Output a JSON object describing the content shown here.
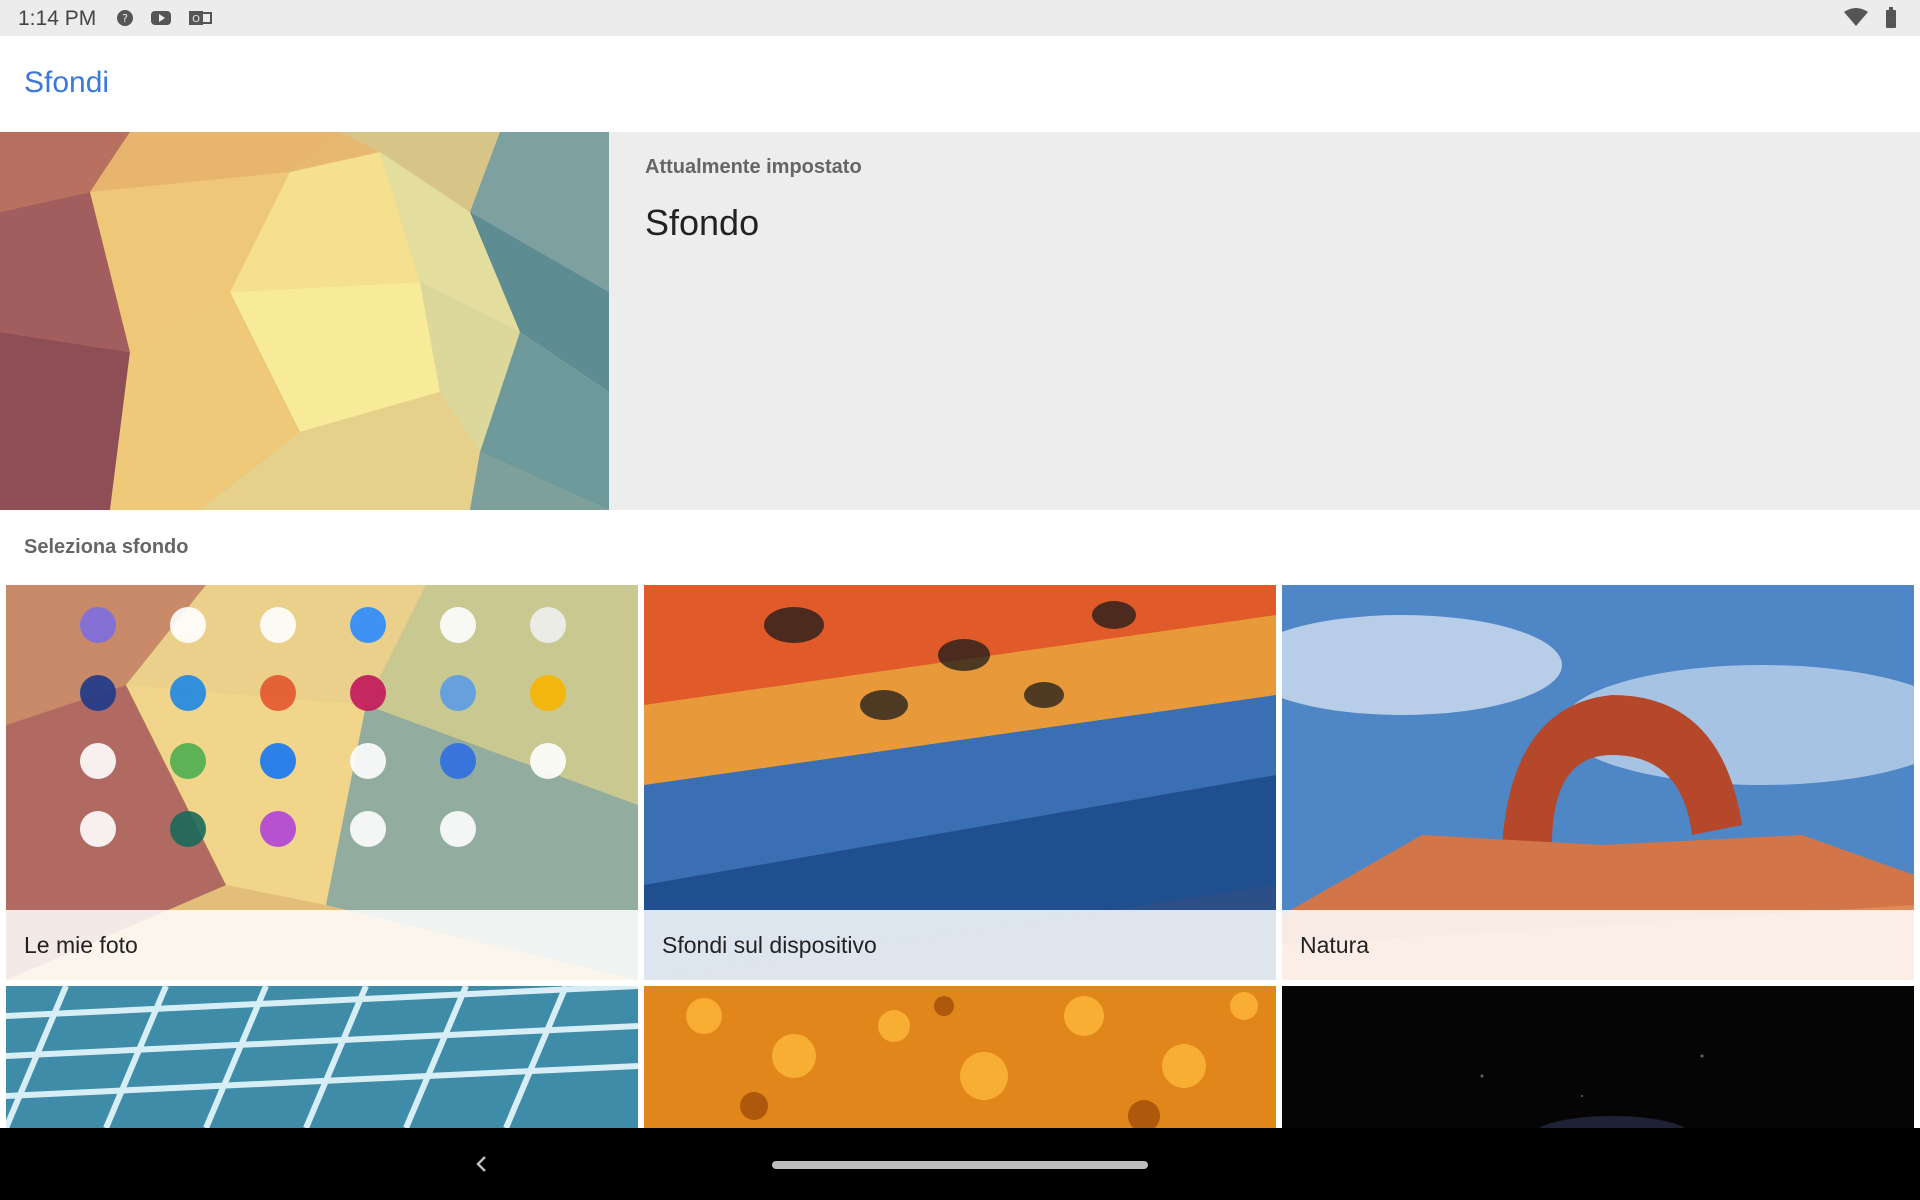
{
  "status_bar": {
    "time": "1:14 PM",
    "icons": [
      "notification-icon",
      "youtube-icon",
      "outlook-icon"
    ],
    "right_icons": [
      "wifi-icon",
      "battery-icon"
    ]
  },
  "app_bar": {
    "title": "Sfondi"
  },
  "current": {
    "subtitle": "Attualmente impostato",
    "name": "Sfondo"
  },
  "section_title": "Seleziona sfondo",
  "tiles": [
    {
      "label": "Le mie foto"
    },
    {
      "label": "Sfondi sul dispositivo"
    },
    {
      "label": "Natura"
    },
    {
      "label": ""
    },
    {
      "label": ""
    },
    {
      "label": ""
    }
  ],
  "navigation": [
    "back-icon",
    "home-gesture-bar"
  ],
  "colors": {
    "accent": "#3b78d8",
    "status_bar": "#ececec",
    "panel": "#ededed",
    "nav": "#000000"
  }
}
